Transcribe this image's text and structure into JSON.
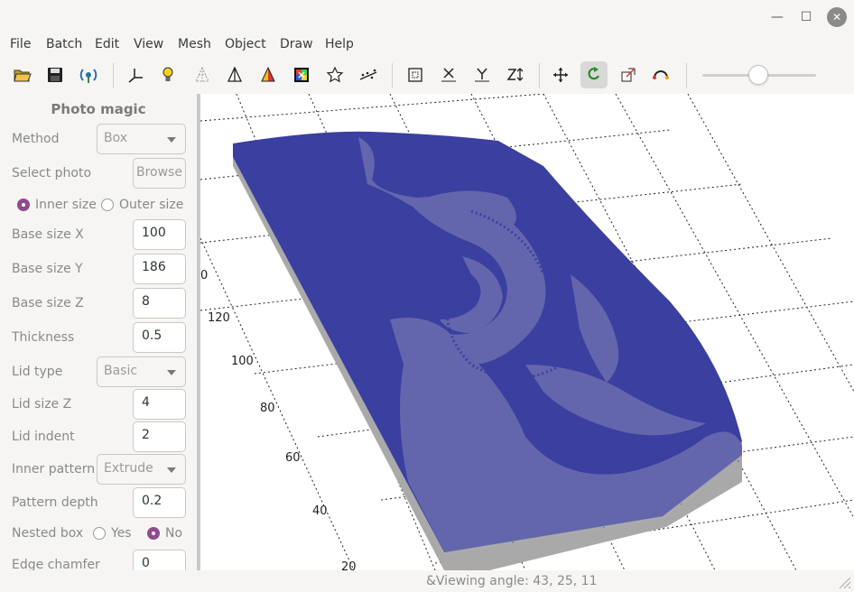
{
  "window": {
    "minimize_glyph": "—",
    "maximize_glyph": "☐",
    "close_glyph": "✕"
  },
  "menu": [
    "File",
    "Batch",
    "Edit",
    "View",
    "Mesh",
    "Object",
    "Draw",
    "Help"
  ],
  "toolbar_icons": [
    "open-folder-icon",
    "save-icon",
    "network-icon",
    "axes-icon",
    "lightbulb-icon",
    "wireframe-icon",
    "shaded-pyramid-icon",
    "colored-pyramid-icon",
    "color-picker-icon",
    "star-icon",
    "scatter-icon",
    "bounding-box-icon",
    "axis-x-icon",
    "axis-y-icon",
    "axis-z-icon",
    "move-icon",
    "rotate-icon",
    "scale-icon",
    "view-angle-icon"
  ],
  "panel": {
    "title": "Photo magic",
    "method_label": "Method",
    "method_value": "Box",
    "select_photo_label": "Select photo",
    "browse_label": "Browse",
    "inner_size_label": "Inner size",
    "outer_size_label": "Outer size",
    "base_x_label": "Base size X",
    "base_x": "100",
    "base_y_label": "Base size Y",
    "base_y": "186",
    "base_z_label": "Base size Z",
    "base_z": "8",
    "thickness_label": "Thickness",
    "thickness": "0.5",
    "lid_type_label": "Lid type",
    "lid_type": "Basic",
    "lid_z_label": "Lid size Z",
    "lid_z": "4",
    "lid_indent_label": "Lid indent",
    "lid_indent": "2",
    "inner_pattern_label": "Inner pattern",
    "inner_pattern": "Extrude",
    "pattern_depth_label": "Pattern depth",
    "pattern_depth": "0.2",
    "nested_box_label": "Nested box",
    "yes_label": "Yes",
    "no_label": "No",
    "edge_chamfer_label": "Edge chamfer",
    "edge_chamfer": "0"
  },
  "viewport": {
    "ticks": [
      "0",
      "120",
      "100",
      "80",
      "60",
      "40",
      "20"
    ],
    "mesh_color": "#3a3fa0",
    "mesh_light": "#6366ac"
  },
  "status": {
    "text": "&Viewing angle: 43, 25, 11"
  }
}
